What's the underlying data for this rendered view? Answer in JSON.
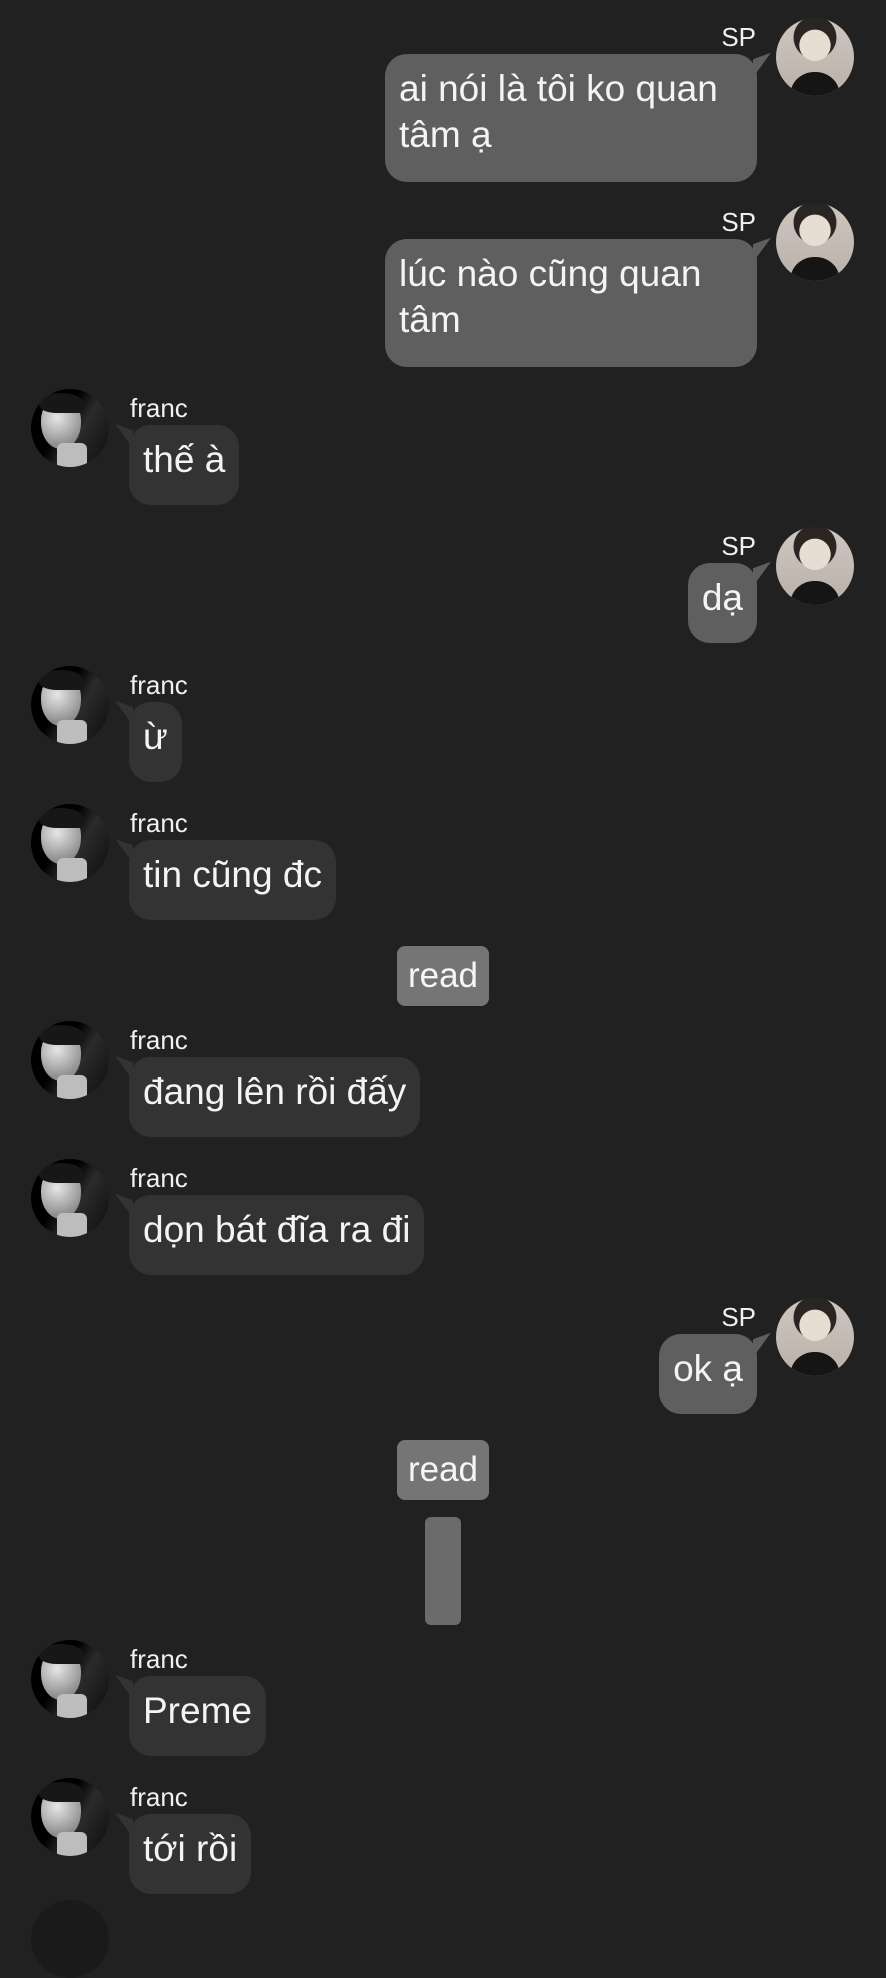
{
  "chat": {
    "messages": [
      {
        "side": "out",
        "sender": "SP",
        "text": "ai nói là tôi ko quan\ntâm ạ"
      },
      {
        "side": "out",
        "sender": "SP",
        "text": "lúc nào cũng quan\ntâm"
      },
      {
        "side": "in",
        "sender": "franc",
        "text": "thế à"
      },
      {
        "side": "out",
        "sender": "SP",
        "text": "dạ"
      },
      {
        "side": "in",
        "sender": "franc",
        "text": "ừ"
      },
      {
        "side": "in",
        "sender": "franc",
        "text": "tin cũng đc"
      },
      {
        "status": "read"
      },
      {
        "side": "in",
        "sender": "franc",
        "text": "đang lên rồi đấy"
      },
      {
        "side": "in",
        "sender": "franc",
        "text": "dọn bát đĩa ra đi"
      },
      {
        "side": "out",
        "sender": "SP",
        "text": "ok ạ"
      },
      {
        "status": "read"
      },
      {
        "side": "in",
        "sender": "franc",
        "text": "Preme"
      },
      {
        "side": "in",
        "sender": "franc",
        "text": "tới rồi"
      }
    ]
  },
  "colors": {
    "background": "#212121",
    "outgoing_bubble": "#5f5f5f",
    "incoming_bubble": "#333333",
    "read_badge": "#757575"
  }
}
